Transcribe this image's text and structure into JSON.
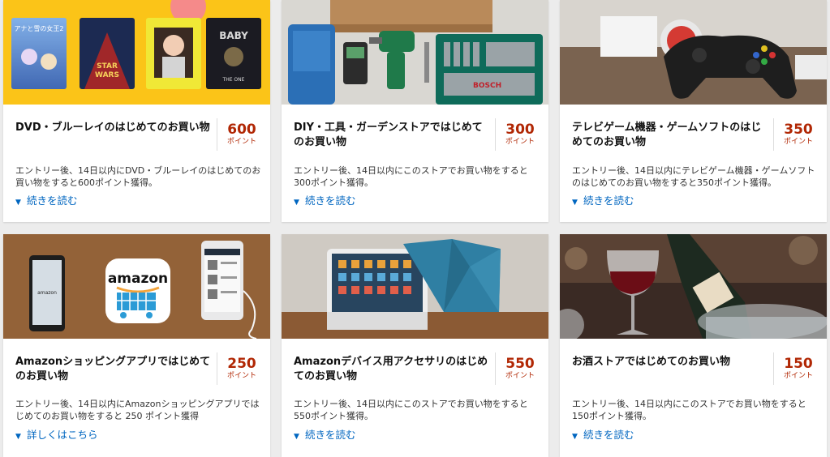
{
  "cards": [
    {
      "title": "DVD・ブルーレイのはじめてのお買い物",
      "points": "600",
      "points_unit": "ポイント",
      "description": "エントリー後、14日以内にDVD・ブルーレイのはじめてのお買い物をすると600ポイント獲得。",
      "link_label": "続きを読む",
      "image": "dvd-covers",
      "image_text": [
        "アナと雪の女王2",
        "STAR WARS",
        "THE ONE"
      ]
    },
    {
      "title": "DIY・工具・ガーデンストアではじめてのお買い物",
      "points": "300",
      "points_unit": "ポイント",
      "description": "エントリー後、14日以内にこのストアでお買い物をすると300ポイント獲得。",
      "link_label": "続きを読む",
      "image": "diy-tools",
      "image_text": [
        "BOSCH"
      ]
    },
    {
      "title": "テレビゲーム機器・ゲームソフトのはじめてのお買い物",
      "points": "350",
      "points_unit": "ポイント",
      "description": "エントリー後、14日以内にテレビゲーム機器・ゲームソフトのはじめてのお買い物をすると350ポイント獲得。",
      "link_label": "続きを読む",
      "image": "game-controller",
      "image_text": []
    },
    {
      "title": "Amazonショッピングアプリではじめてのお買い物",
      "points": "250",
      "points_unit": "ポイント",
      "description": "エントリー後、14日以内にAmazonショッピングアプリではじめてのお買い物をすると 250 ポイント獲得",
      "link_label": "詳しくはこちら",
      "image": "amazon-app",
      "image_text": [
        "amazon"
      ]
    },
    {
      "title": "Amazonデバイス用アクセサリのはじめてのお買い物",
      "points": "550",
      "points_unit": "ポイント",
      "description": "エントリー後、14日以内にこのストアでお買い物をすると550ポイント獲得。",
      "link_label": "続きを読む",
      "image": "tablet",
      "image_text": []
    },
    {
      "title": "お酒ストアではじめてのお買い物",
      "points": "150",
      "points_unit": "ポイント",
      "description": "エントリー後、14日以内にこのストアでお買い物をすると150ポイント獲得。",
      "link_label": "続きを読む",
      "image": "wine",
      "image_text": []
    }
  ],
  "colors": {
    "points": "#b12704",
    "link": "#0066c0",
    "background": "#ececec"
  }
}
